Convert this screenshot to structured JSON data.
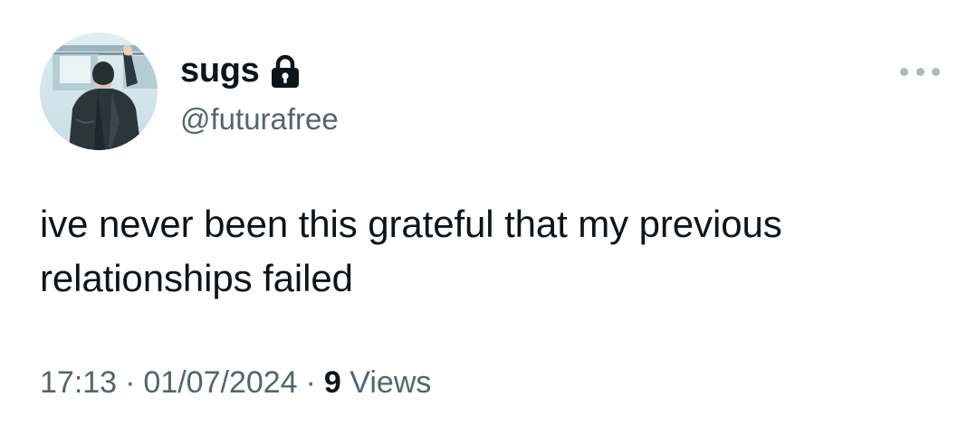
{
  "author": {
    "display_name": "sugs",
    "handle": "@futurafree",
    "avatar_icon": "avatar-person-on-train-illustration",
    "protected_icon": "lock-icon"
  },
  "tweet": {
    "text": "ive never been this grateful that my previous\nrelationships failed",
    "time": "17:13",
    "date": "01/07/2024",
    "separator": "·",
    "views_count": "9",
    "views_label": "Views"
  },
  "menu": {
    "more_icon": "more-options-icon"
  },
  "colors": {
    "text_primary": "#0f1419",
    "text_secondary": "#536471",
    "more_dots": "#aeb7be",
    "background": "#ffffff"
  }
}
